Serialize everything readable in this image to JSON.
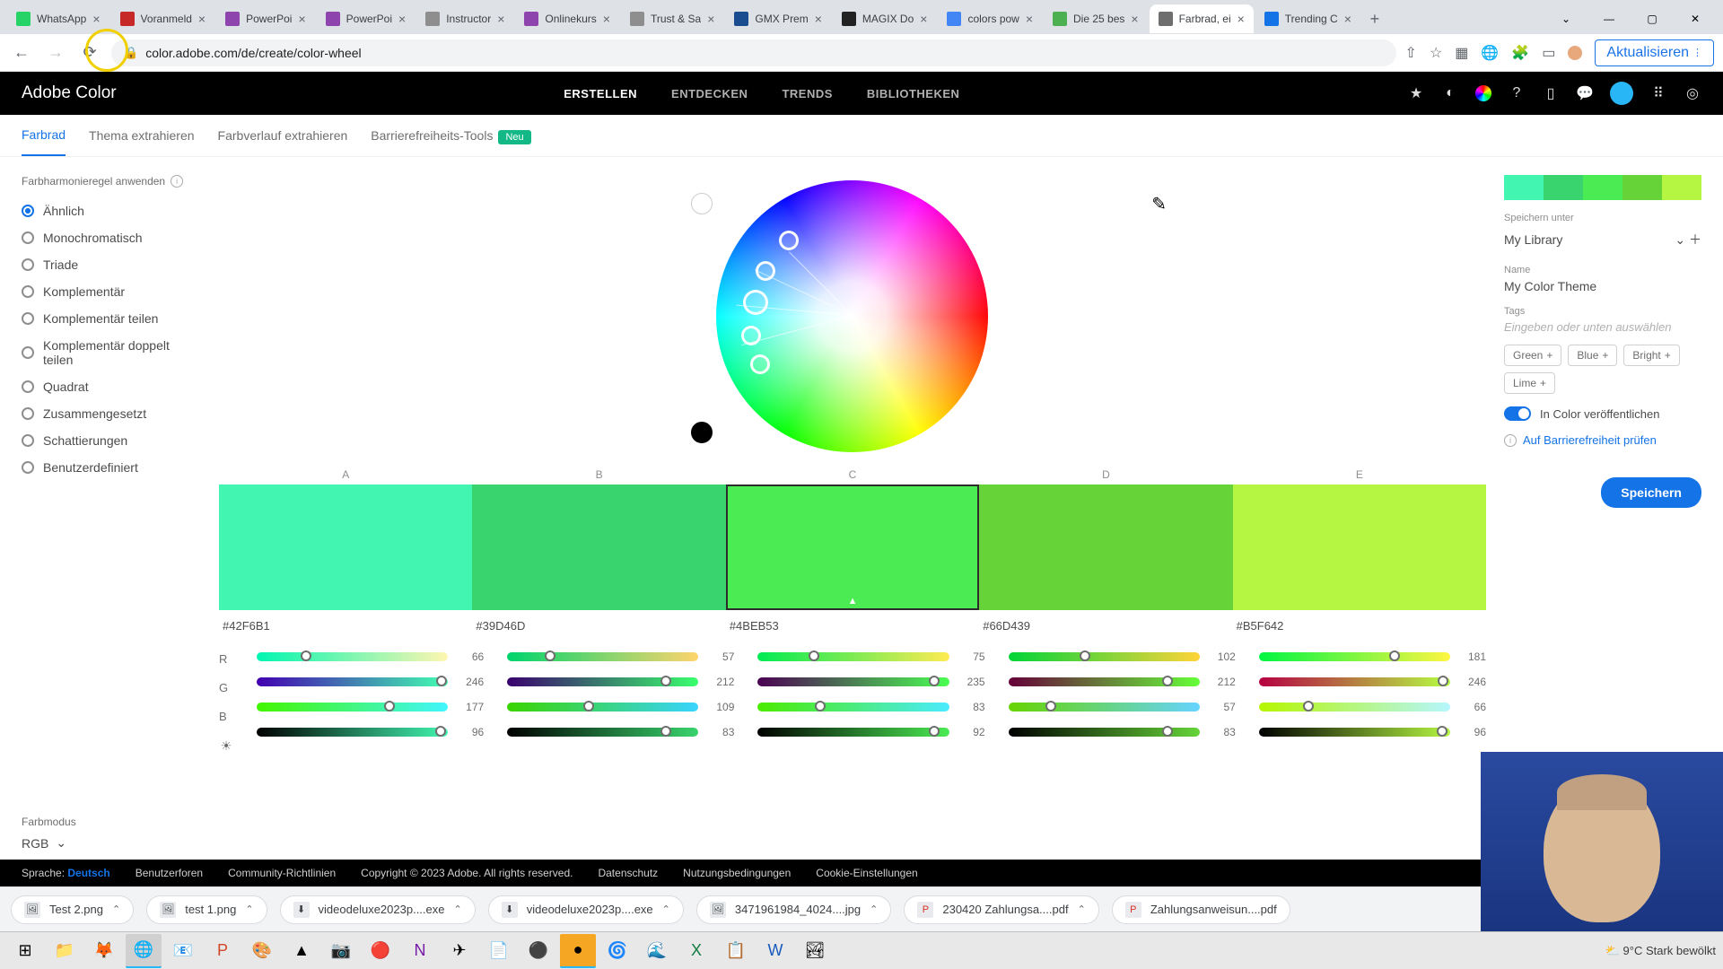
{
  "browser": {
    "tabs": [
      {
        "title": "WhatsApp",
        "color": "#25d366"
      },
      {
        "title": "Voranmeld",
        "color": "#c62828"
      },
      {
        "title": "PowerPoi",
        "color": "#8e44ad"
      },
      {
        "title": "PowerPoi",
        "color": "#8e44ad"
      },
      {
        "title": "Instructor",
        "color": "#8e8e8e"
      },
      {
        "title": "Onlinekurs",
        "color": "#8e44ad"
      },
      {
        "title": "Trust & Sa",
        "color": "#8e8e8e"
      },
      {
        "title": "GMX Prem",
        "color": "#1a4d8f"
      },
      {
        "title": "MAGIX Do",
        "color": "#222"
      },
      {
        "title": "colors pow",
        "color": "#4285f4"
      },
      {
        "title": "Die 25 bes",
        "color": "#4caf50"
      },
      {
        "title": "Farbrad, ei",
        "color": "#6e6e6e",
        "active": true
      },
      {
        "title": "Trending C",
        "color": "#1473e6"
      }
    ],
    "url": "color.adobe.com/de/create/color-wheel",
    "aktualisieren": "Aktualisieren"
  },
  "header": {
    "logo": "Adobe Color",
    "nav": [
      "ERSTELLEN",
      "ENTDECKEN",
      "TRENDS",
      "BIBLIOTHEKEN"
    ]
  },
  "subtabs": {
    "items": [
      "Farbrad",
      "Thema extrahieren",
      "Farbverlauf extrahieren",
      "Barrierefreiheits-Tools"
    ],
    "neu": "Neu"
  },
  "harmony": {
    "label": "Farbharmonieregel anwenden",
    "options": [
      "Ähnlich",
      "Monochromatisch",
      "Triade",
      "Komplementär",
      "Komplementär teilen",
      "Komplementär doppelt teilen",
      "Quadrat",
      "Zusammengesetzt",
      "Schattierungen",
      "Benutzerdefiniert"
    ]
  },
  "farbmodus": {
    "label": "Farbmodus",
    "value": "RGB"
  },
  "swatches": {
    "labels": [
      "A",
      "B",
      "C",
      "D",
      "E"
    ],
    "colors": [
      "#42F6B1",
      "#39D46D",
      "#4BEB53",
      "#66D439",
      "#B5F642"
    ],
    "hex": [
      "#42F6B1",
      "#39D46D",
      "#4BEB53",
      "#66D439",
      "#B5F642"
    ],
    "rgb": [
      {
        "r": 66,
        "g": 246,
        "b": 177,
        "l": 96
      },
      {
        "r": 57,
        "g": 212,
        "b": 109,
        "l": 83
      },
      {
        "r": 75,
        "g": 235,
        "b": 83,
        "l": 92
      },
      {
        "r": 102,
        "g": 212,
        "b": 57,
        "l": 83
      },
      {
        "r": 181,
        "g": 246,
        "b": 66,
        "l": 96
      }
    ]
  },
  "sidebar": {
    "speichern_label": "Speichern unter",
    "library": "My Library",
    "name_label": "Name",
    "name_value": "My Color Theme",
    "tags_label": "Tags",
    "tags_placeholder": "Eingeben oder unten auswählen",
    "tag_chips": [
      "Green",
      "Blue",
      "Bright",
      "Lime"
    ],
    "publish_label": "In Color veröffentlichen",
    "a11y_label": "Auf Barrierefreiheit prüfen",
    "save_btn": "Speichern"
  },
  "footer": {
    "sprache_label": "Sprache:",
    "sprache": "Deutsch",
    "links": [
      "Benutzerforen",
      "Community-Richtlinien"
    ],
    "copyright": "Copyright © 2023 Adobe. All rights reserved.",
    "links2": [
      "Datenschutz",
      "Nutzungsbedingungen",
      "Cookie-Einstellungen"
    ]
  },
  "downloads": [
    "Test 2.png",
    "test 1.png",
    "videodeluxe2023p....exe",
    "videodeluxe2023p....exe",
    "3471961984_4024....jpg",
    "230420 Zahlungsa....pdf",
    "Zahlungsanweisun....pdf"
  ],
  "taskbar": {
    "weather": "9°C  Stark bewölkt"
  }
}
